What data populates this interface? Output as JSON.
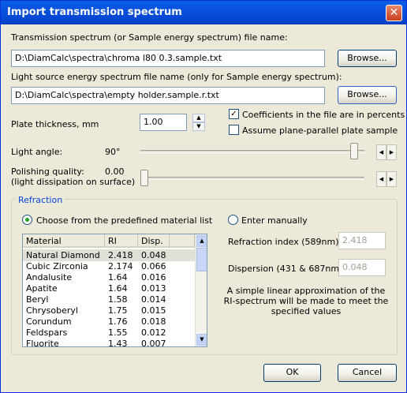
{
  "title": "Import transmission spectrum",
  "close_glyph": "✕",
  "trans": {
    "label": "Transmission spectrum (or Sample energy spectrum) file name:",
    "value": "D:\\DiamCalc\\spectra\\chroma l80 0.3.sample.txt",
    "browse": "Browse..."
  },
  "light": {
    "label": "Light source energy spectrum file name (only for Sample energy spectrum):",
    "value": "D:\\DiamCalc\\spectra\\empty holder.sample.r.txt",
    "browse": "Browse..."
  },
  "plate": {
    "label": "Plate thickness, mm",
    "value": "1.00",
    "up": "▲",
    "down": "▼"
  },
  "coef": {
    "label": "Coefficients in the file are in percents",
    "checked": true,
    "mark": "✓"
  },
  "assume": {
    "label": "Assume plane-parallel plate sample",
    "checked": false
  },
  "angle": {
    "label": "Light angle:",
    "value": "90°",
    "position_fraction": 0.97
  },
  "polish": {
    "label1": "Polishing quality:",
    "label2": "(light dissipation on surface)",
    "value": "0.00",
    "position_fraction": 0.0
  },
  "arrows": {
    "left": "◀",
    "right": "▶"
  },
  "refraction": {
    "title": "Refraction",
    "choose_label": "Choose from the predefined material list",
    "manual_label": "Enter manually",
    "selected": "choose",
    "index_label": "Refraction index (589nm)",
    "index_value": "2.418",
    "disp_label": "Dispersion (431 & 687nm)",
    "disp_value": "0.048",
    "note": [
      "A simple linear approximation of the",
      "RI-spectrum will be made to meet the",
      "specified values"
    ]
  },
  "table": {
    "headers": [
      "Material",
      "RI",
      "Disp."
    ],
    "rows": [
      [
        "Natural Diamond",
        "2.418",
        "0.048"
      ],
      [
        "Cubic Zirconia",
        "2.174",
        "0.066"
      ],
      [
        "Andalusite",
        "1.64",
        "0.016"
      ],
      [
        "Apatite",
        "1.64",
        "0.013"
      ],
      [
        "Beryl",
        "1.58",
        "0.014"
      ],
      [
        "Chrysoberyl",
        "1.75",
        "0.015"
      ],
      [
        "Corundum",
        "1.76",
        "0.018"
      ],
      [
        "Feldspars",
        "1.55",
        "0.012"
      ],
      [
        "Fluorite",
        "1.43",
        "0.007"
      ]
    ],
    "selected_row": 0,
    "scroll_up": "▲",
    "scroll_down": "▼"
  },
  "ok": "OK",
  "cancel": "Cancel"
}
